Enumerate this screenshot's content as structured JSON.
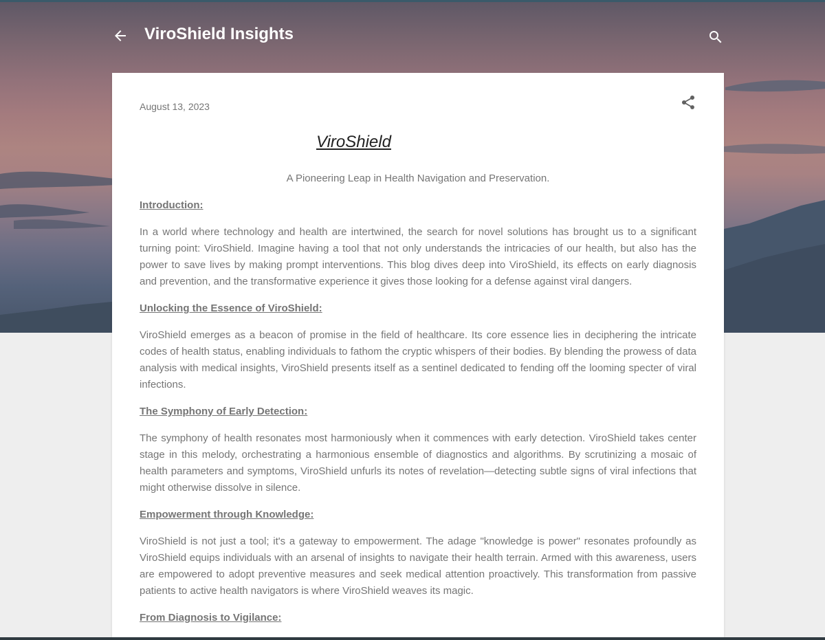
{
  "header": {
    "blog_title": "ViroShield Insights"
  },
  "post": {
    "date": "August 13, 2023",
    "title": "ViroShield",
    "subtitle": "A Pioneering Leap in Health Navigation and Preservation.",
    "sections": [
      {
        "heading": "Introduction:",
        "text": "In a world where technology and health are intertwined, the search for novel solutions has brought us to a significant turning point: ViroShield. Imagine having a tool that not only understands the intricacies of our health, but also has the power to save lives by making prompt interventions. This blog dives deep into ViroShield, its effects on early diagnosis and prevention, and the transformative experience it gives those looking for a defense against viral dangers."
      },
      {
        "heading": "Unlocking the Essence of ViroShield:",
        "text": "ViroShield emerges as a beacon of promise in the field of healthcare. Its core essence lies in deciphering the intricate codes of health status, enabling individuals to fathom the cryptic whispers of their bodies. By blending the prowess of data analysis with medical insights, ViroShield presents itself as a sentinel dedicated to fending off the looming specter of viral infections."
      },
      {
        "heading": "The Symphony of Early Detection:",
        "text": "The symphony of health resonates most harmoniously when it commences with early detection. ViroShield takes center stage in this melody, orchestrating a harmonious ensemble of diagnostics and algorithms. By scrutinizing a mosaic of health parameters and symptoms, ViroShield unfurls its notes of revelation—detecting subtle signs of viral infections that might otherwise dissolve in silence."
      },
      {
        "heading": "Empowerment through Knowledge:",
        "text": "ViroShield is not just a tool; it's a gateway to empowerment. The adage \"knowledge is power\" resonates profoundly as ViroShield equips individuals with an arsenal of insights to navigate their health terrain. Armed with this awareness, users are empowered to adopt preventive measures and seek medical attention proactively. This transformation from passive patients to active health navigators is where ViroShield weaves its magic."
      },
      {
        "heading": "From Diagnosis to Vigilance:",
        "text": ""
      }
    ]
  },
  "icons": {
    "back": "arrow-back-icon",
    "search": "search-icon",
    "share": "share-icon"
  },
  "colors": {
    "title_white": "#ffffff",
    "body_text": "#757575",
    "heading_text": "#212121",
    "page_background": "#eeeeee"
  }
}
